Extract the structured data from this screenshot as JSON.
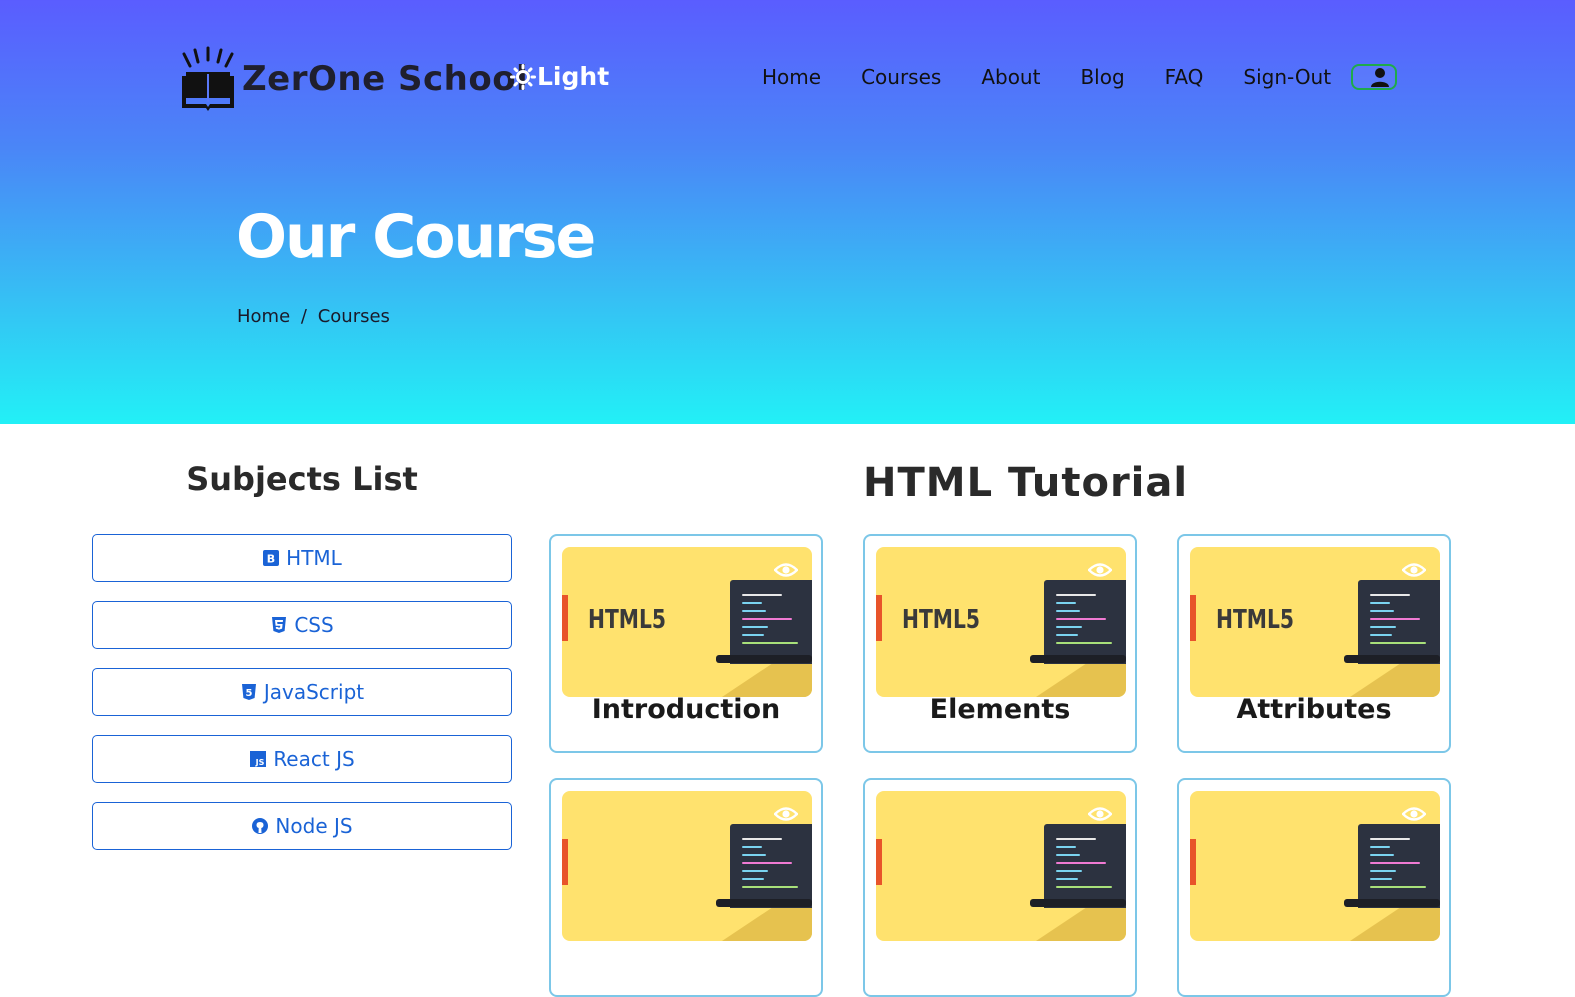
{
  "header": {
    "logo_text": "ZerOne School",
    "logo_icon": "book-icon",
    "theme_label": "Light",
    "theme_icon": "sun-icon"
  },
  "nav": {
    "items": [
      {
        "label": "Home"
      },
      {
        "label": "Courses"
      },
      {
        "label": "About"
      },
      {
        "label": "Blog"
      },
      {
        "label": "FAQ"
      },
      {
        "label": "Sign-Out"
      }
    ],
    "user_icon": "user-icon",
    "user_toggle_color": "#1faa4a"
  },
  "hero": {
    "title": "Our Course",
    "breadcrumb": {
      "home": "Home",
      "separator": "/",
      "current": "Courses"
    },
    "gradient_top": "#5a5dff",
    "gradient_bottom": "#22f0f6"
  },
  "sidebar": {
    "title": "Subjects List",
    "items": [
      {
        "label": "HTML",
        "icon": "bootstrap-icon"
      },
      {
        "label": "CSS",
        "icon": "css3-icon"
      },
      {
        "label": "JavaScript",
        "icon": "html5-icon"
      },
      {
        "label": "React JS",
        "icon": "js-icon"
      },
      {
        "label": "Node JS",
        "icon": "github-icon"
      }
    ],
    "accent": "#1a63d6"
  },
  "main": {
    "title": "HTML Tutorial",
    "cards": [
      {
        "title": "Introduction",
        "thumb_label": "HTML5"
      },
      {
        "title": "Elements",
        "thumb_label": "HTML5"
      },
      {
        "title": "Attributes",
        "thumb_label": "HTML5"
      },
      {
        "title": "",
        "thumb_label": ""
      },
      {
        "title": "",
        "thumb_label": ""
      },
      {
        "title": "",
        "thumb_label": ""
      }
    ],
    "card_border": "#7cc7e8",
    "thumb_color": "#ffe26e"
  }
}
